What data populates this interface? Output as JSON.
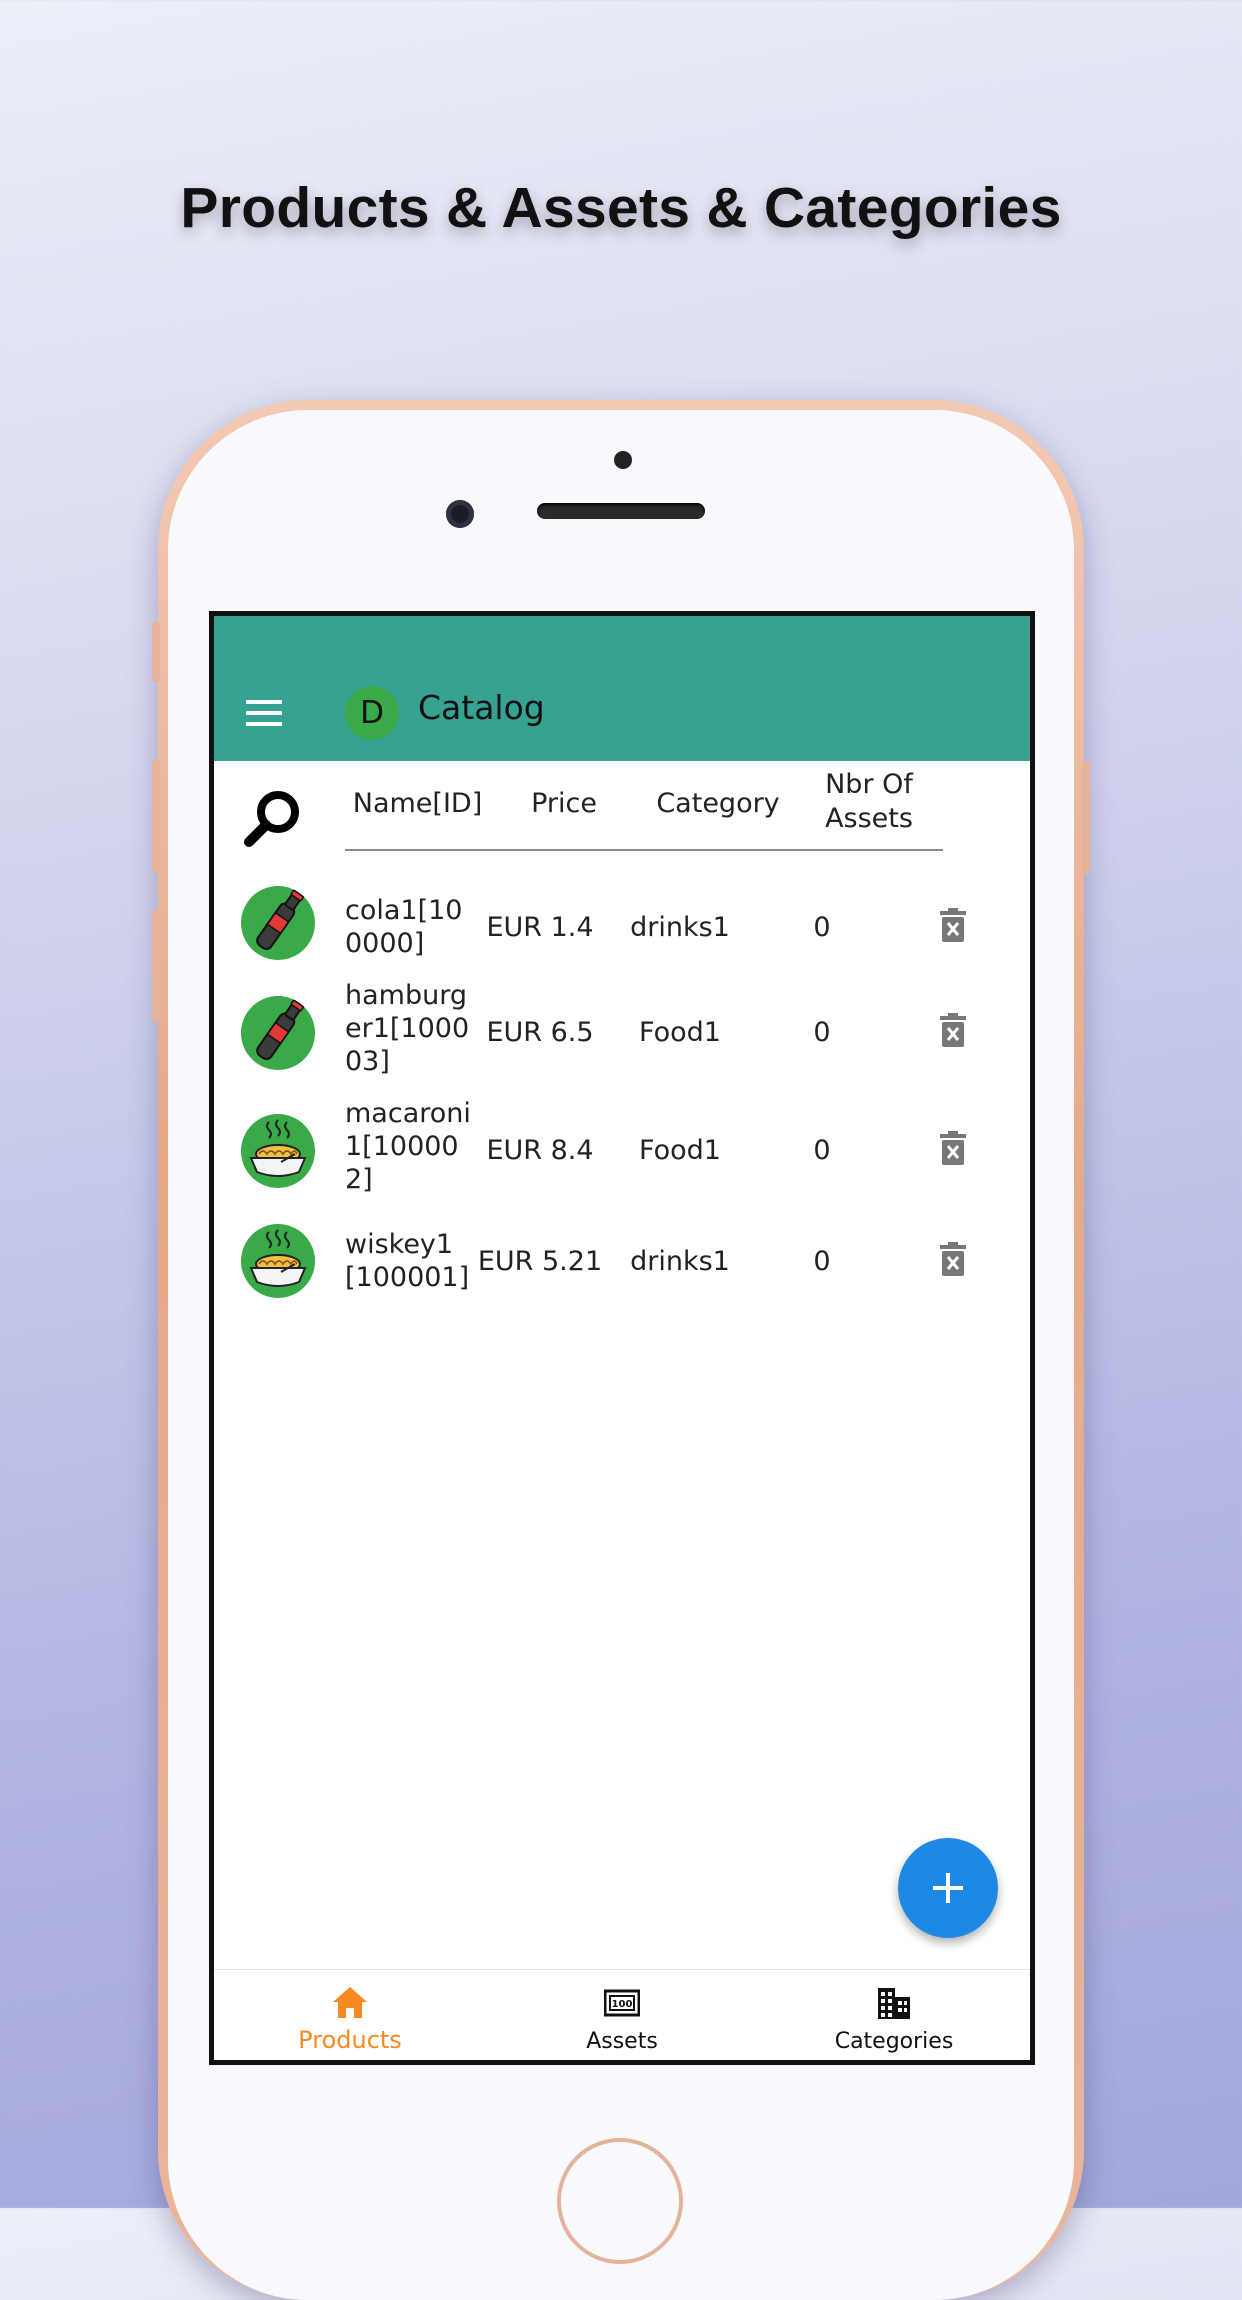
{
  "headline": "Products & Assets & Categories",
  "app": {
    "title": "Catalog",
    "avatar_letter": "D"
  },
  "table": {
    "headers": {
      "name": "Name[ID]",
      "price": "Price",
      "category": "Category",
      "assets_line1": "Nbr Of",
      "assets_line2": "Assets"
    },
    "rows": [
      {
        "name": "cola1[100000]",
        "price": "EUR 1.4",
        "category": "drinks1",
        "assets": "0",
        "icon": "cola-bottle-icon"
      },
      {
        "name": "hamburger1[100003]",
        "price": "EUR 6.5",
        "category": "Food1",
        "assets": "0",
        "icon": "cola-bottle-icon"
      },
      {
        "name": "macaroni1[100002]",
        "price": "EUR 8.4",
        "category": "Food1",
        "assets": "0",
        "icon": "noodles-bowl-icon"
      },
      {
        "name": "wiskey1[100001]",
        "price": "EUR 5.21",
        "category": "drinks1",
        "assets": "0",
        "icon": "noodles-bowl-icon"
      }
    ]
  },
  "bottom_nav": {
    "items": [
      {
        "label": "Products",
        "icon": "home-icon",
        "active": true
      },
      {
        "label": "Assets",
        "icon": "cash-icon",
        "active": false
      },
      {
        "label": "Categories",
        "icon": "building-icon",
        "active": false
      }
    ]
  },
  "colors": {
    "appbar": "#37a192",
    "active_tab": "#f58a23",
    "fab": "#1e88e5",
    "avatar": "#3aa948",
    "icon_circle": "#3aa948"
  }
}
